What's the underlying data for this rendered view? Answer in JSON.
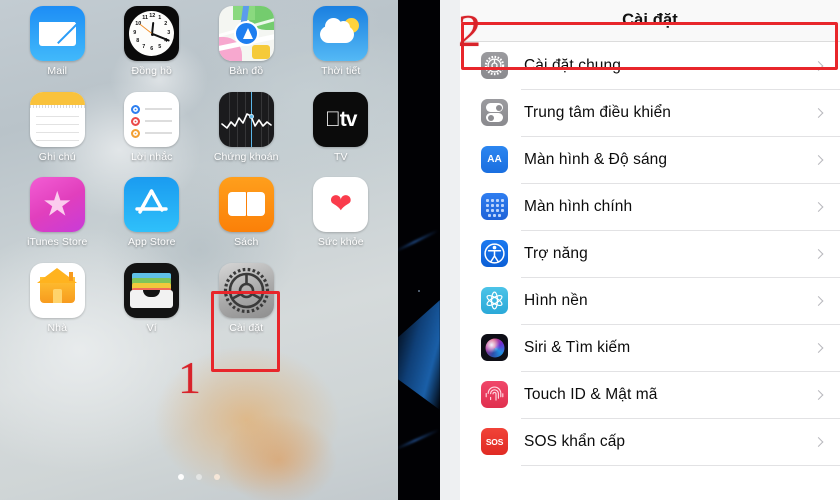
{
  "left_panel": {
    "name": "ios-home-screen",
    "apps": [
      {
        "label": "Mail",
        "icon": "mail-icon"
      },
      {
        "label": "Đồng hồ",
        "icon": "clock-icon"
      },
      {
        "label": "Bản đồ",
        "icon": "maps-icon"
      },
      {
        "label": "Thời tiết",
        "icon": "weather-icon"
      },
      {
        "label": "Ghi chú",
        "icon": "notes-icon"
      },
      {
        "label": "Lời nhắc",
        "icon": "reminders-icon"
      },
      {
        "label": "Chứng khoán",
        "icon": "stocks-icon"
      },
      {
        "label": "TV",
        "icon": "tv-icon"
      },
      {
        "label": "iTunes Store",
        "icon": "itunes-store-icon"
      },
      {
        "label": "App Store",
        "icon": "app-store-icon"
      },
      {
        "label": "Sách",
        "icon": "books-icon"
      },
      {
        "label": "Sức khỏe",
        "icon": "health-icon"
      },
      {
        "label": "Nhà",
        "icon": "home-app-icon"
      },
      {
        "label": "Ví",
        "icon": "wallet-icon"
      },
      {
        "label": "Cài đặt",
        "icon": "settings-gear-icon"
      }
    ],
    "tv_icon_text": "tv",
    "step_marker": "1",
    "page_dots": {
      "count": 3,
      "active_index": 0
    },
    "highlight_color": "#e8262b"
  },
  "right_panel": {
    "name": "ios-settings-screen",
    "nav_title": "Cài đặt",
    "step_marker": "2",
    "highlight_color": "#e8262b",
    "highlighted_row_index": 0,
    "rows": [
      {
        "label": "Cài đặt chung",
        "icon": "gear-icon"
      },
      {
        "label": "Trung tâm điều khiển",
        "icon": "control-center-icon"
      },
      {
        "label": "Màn hình & Độ sáng",
        "icon": "display-brightness-icon",
        "icon_text": "AA"
      },
      {
        "label": "Màn hình chính",
        "icon": "home-screen-icon"
      },
      {
        "label": "Trợ năng",
        "icon": "accessibility-icon"
      },
      {
        "label": "Hình nền",
        "icon": "wallpaper-icon"
      },
      {
        "label": "Siri & Tìm kiếm",
        "icon": "siri-icon"
      },
      {
        "label": "Touch ID & Mật mã",
        "icon": "touch-id-icon"
      },
      {
        "label": "SOS khẩn cấp",
        "icon": "sos-icon",
        "icon_text": "SOS"
      }
    ]
  },
  "clock_numerals": [
    "12",
    "1",
    "2",
    "3",
    "4",
    "5",
    "6",
    "7",
    "8",
    "9",
    "10",
    "11"
  ]
}
